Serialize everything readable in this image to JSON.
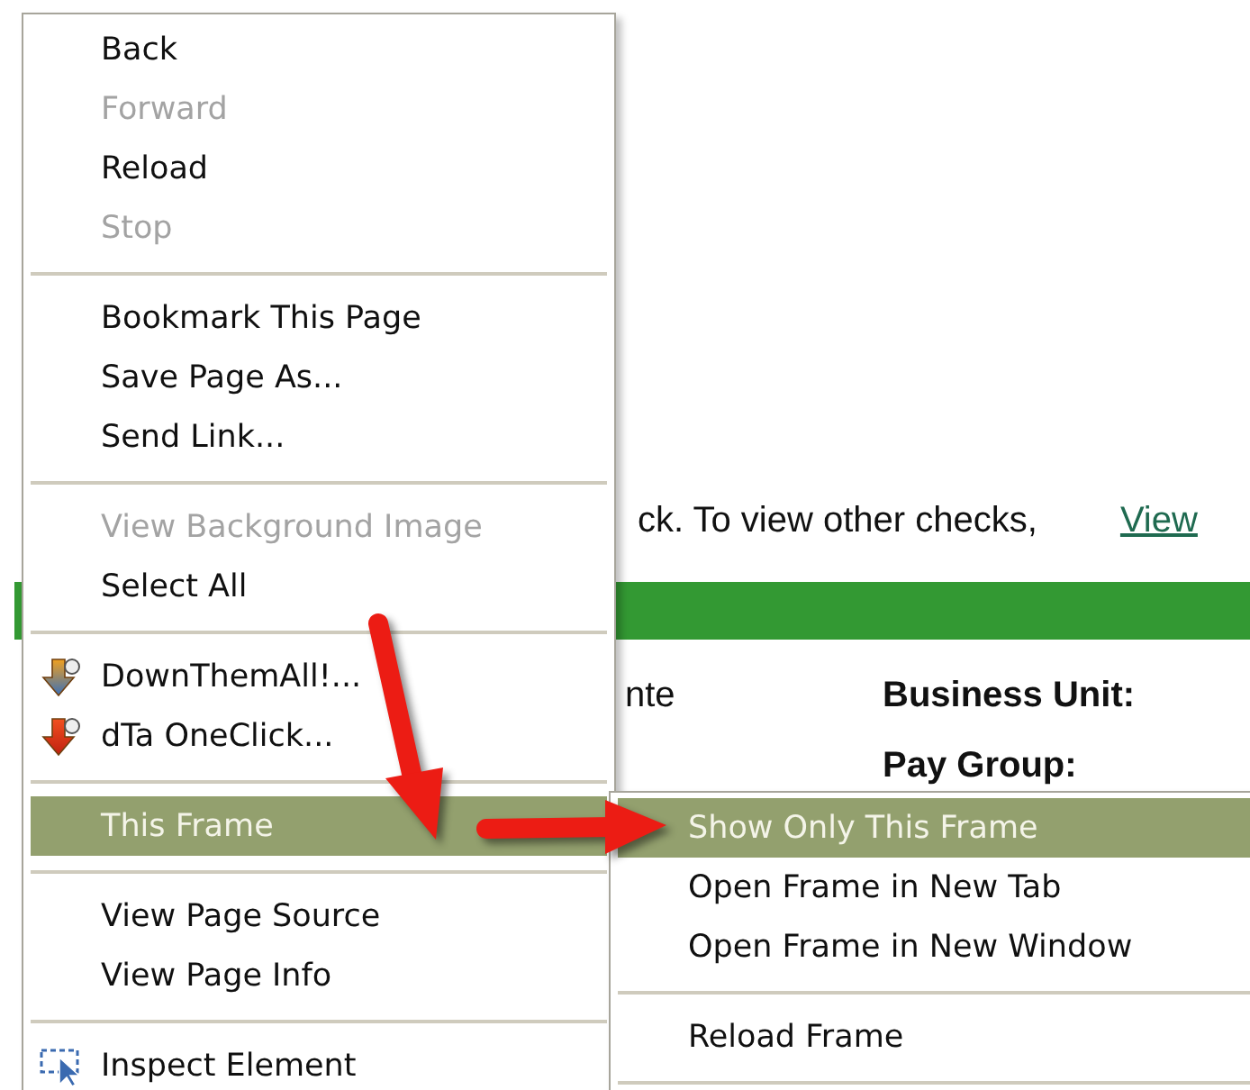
{
  "page": {
    "notice": "ck.  To view other checks,",
    "link": "View",
    "name_fragment": "nte",
    "labels": [
      "Business Unit:",
      "Pay Group:"
    ]
  },
  "context_menu": {
    "items": [
      {
        "kind": "plain",
        "label": "Back",
        "disabled": false,
        "selected": false
      },
      {
        "kind": "plain",
        "label": "Forward",
        "disabled": true,
        "selected": false
      },
      {
        "kind": "plain",
        "label": "Reload",
        "disabled": false,
        "selected": false
      },
      {
        "kind": "plain",
        "label": "Stop",
        "disabled": true,
        "selected": false
      },
      {
        "kind": "separator"
      },
      {
        "kind": "plain",
        "label": "Bookmark This Page",
        "disabled": false,
        "selected": false
      },
      {
        "kind": "plain",
        "label": "Save Page As...",
        "disabled": false,
        "selected": false
      },
      {
        "kind": "plain",
        "label": "Send Link...",
        "disabled": false,
        "selected": false
      },
      {
        "kind": "separator"
      },
      {
        "kind": "plain",
        "label": "View Background Image",
        "disabled": true,
        "selected": false
      },
      {
        "kind": "plain",
        "label": "Select All",
        "disabled": false,
        "selected": false
      },
      {
        "kind": "separator"
      },
      {
        "kind": "download",
        "label": "DownThemAll!...",
        "disabled": false,
        "selected": false
      },
      {
        "kind": "quickdownload",
        "label": "dTa OneClick...",
        "disabled": false,
        "selected": false
      },
      {
        "kind": "separator"
      },
      {
        "kind": "submenu",
        "label": "This Frame",
        "disabled": false,
        "selected": true
      },
      {
        "kind": "separator"
      },
      {
        "kind": "plain",
        "label": "View Page Source",
        "disabled": false,
        "selected": false
      },
      {
        "kind": "plain",
        "label": "View Page Info",
        "disabled": false,
        "selected": false
      },
      {
        "kind": "separator"
      },
      {
        "kind": "inspect",
        "label": "Inspect Element",
        "disabled": false,
        "selected": false
      }
    ]
  },
  "submenu": {
    "items": [
      {
        "kind": "plain",
        "label": "Show Only This Frame",
        "disabled": false,
        "selected": true
      },
      {
        "kind": "plain",
        "label": "Open Frame in New Tab",
        "disabled": false,
        "selected": false
      },
      {
        "kind": "plain",
        "label": "Open Frame in New Window",
        "disabled": false,
        "selected": false
      },
      {
        "kind": "separator"
      },
      {
        "kind": "plain",
        "label": "Reload Frame",
        "disabled": false,
        "selected": false
      },
      {
        "kind": "separator"
      }
    ]
  }
}
